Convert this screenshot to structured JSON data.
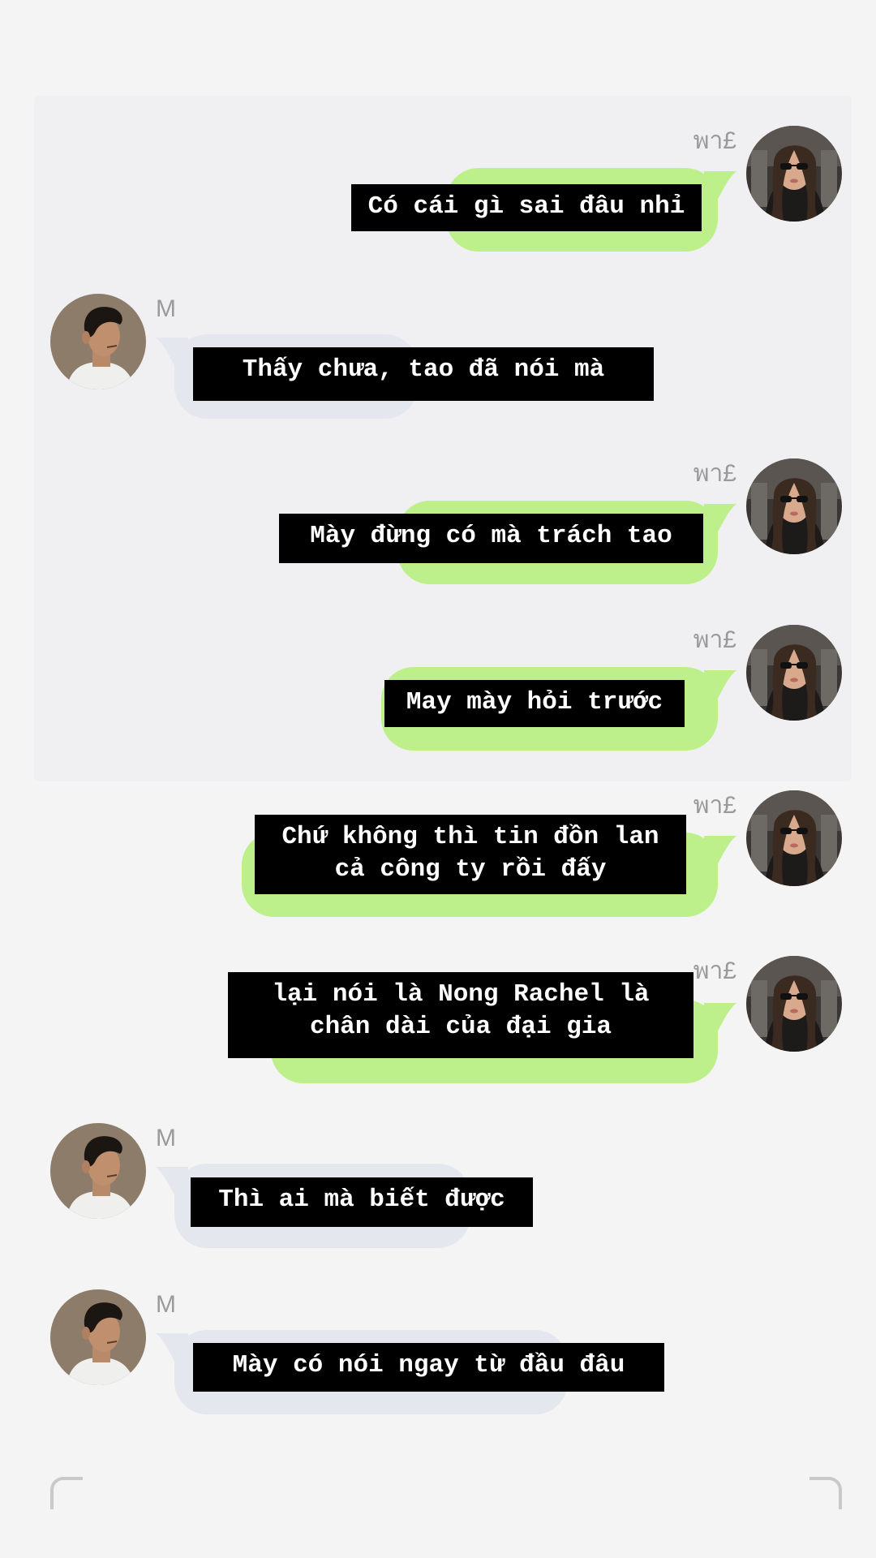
{
  "senders": {
    "right": "พา£",
    "left": "M"
  },
  "messages": [
    {
      "side": "right",
      "sender": "พา£",
      "caption": "Có cái gì sai đâu nhỉ"
    },
    {
      "side": "left",
      "sender": "M",
      "caption": "Thấy chưa, tao đã nói mà"
    },
    {
      "side": "right",
      "sender": "พา£",
      "caption": "Mày đừng có mà trách tao"
    },
    {
      "side": "right",
      "sender": "พา£",
      "caption": "May mày hỏi trước"
    },
    {
      "side": "right",
      "sender": "พา£",
      "caption": "Chứ không thì tin đồn lan\ncả công ty rồi đấy"
    },
    {
      "side": "right",
      "sender": "พา£",
      "caption": "lại nói là Nong Rachel là\nchân dài của đại gia"
    },
    {
      "side": "left",
      "sender": "M",
      "caption": "Thì ai mà biết được"
    },
    {
      "side": "left",
      "sender": "M",
      "caption": "Mày có nói ngay từ đầu đâu"
    }
  ],
  "colors": {
    "background": "#f4f4f5",
    "outgoing_bubble": "#bdf08a",
    "incoming_bubble": "#e4e8ee",
    "caption_bg": "#000000",
    "caption_text": "#ffffff",
    "sender_text": "#9a9a9a"
  },
  "icons": {
    "right_avatar": "woman-sunglasses-avatar",
    "left_avatar": "man-profile-avatar"
  }
}
